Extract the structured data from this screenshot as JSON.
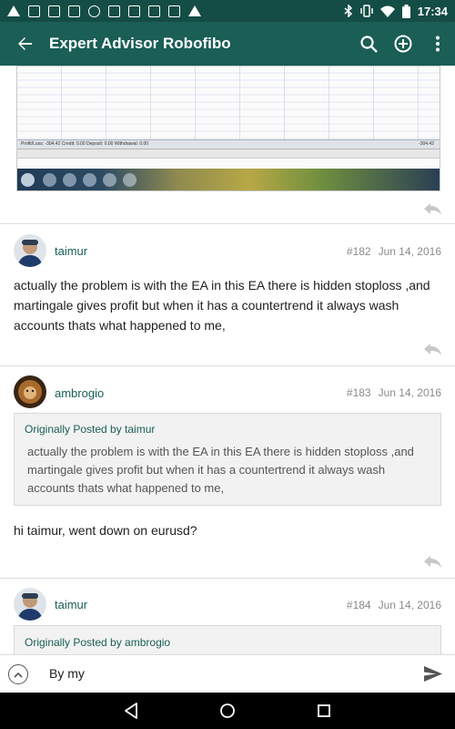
{
  "status_bar": {
    "time": "17:34"
  },
  "app_bar": {
    "title": "Expert Advisor Robofibo",
    "back_icon": "arrow-back-icon",
    "search_icon": "search-icon",
    "add_icon": "add-circle-icon",
    "more_icon": "more-vert-icon"
  },
  "attachment": {
    "status_line": "Profit/Loss: -304.42  Credit: 0.00  Deposit: 0.00  Withdrawal: 0.00",
    "total": "-304.42"
  },
  "posts": [
    {
      "username": "taimur",
      "number": "#182",
      "date": "Jun 14, 2016",
      "text": "actually the problem is with the EA in this EA there is hidden stoploss ,and martingale gives profit but when it has a countertrend it always wash accounts thats what happened to me,"
    },
    {
      "username": "ambrogio",
      "number": "#183",
      "date": "Jun 14, 2016",
      "quote_header": "Originally Posted by taimur",
      "quote_text": "actually the problem is with the EA in this EA there is hidden stoploss ,and martingale gives profit but when it has a countertrend it always wash accounts thats what happened to me,",
      "text": "hi taimur, went down on eurusd?"
    },
    {
      "username": "taimur",
      "number": "#184",
      "date": "Jun 14, 2016",
      "quote_header": "Originally Posted by ambrogio"
    }
  ],
  "reply_bar": {
    "input_value": "By my"
  },
  "colors": {
    "primary": "#1a5e55",
    "primary_dark": "#144d45",
    "accent_text": "#1a5e55"
  }
}
